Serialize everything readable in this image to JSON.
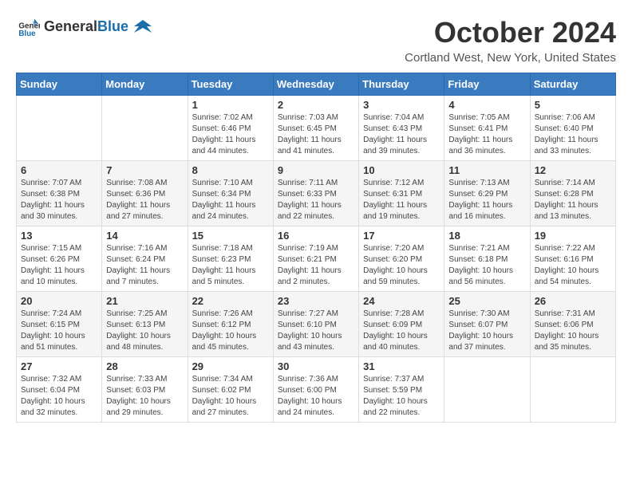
{
  "header": {
    "logo_general": "General",
    "logo_blue": "Blue",
    "month": "October 2024",
    "location": "Cortland West, New York, United States"
  },
  "weekdays": [
    "Sunday",
    "Monday",
    "Tuesday",
    "Wednesday",
    "Thursday",
    "Friday",
    "Saturday"
  ],
  "weeks": [
    [
      {
        "day": "",
        "info": ""
      },
      {
        "day": "",
        "info": ""
      },
      {
        "day": "1",
        "info": "Sunrise: 7:02 AM\nSunset: 6:46 PM\nDaylight: 11 hours and 44 minutes."
      },
      {
        "day": "2",
        "info": "Sunrise: 7:03 AM\nSunset: 6:45 PM\nDaylight: 11 hours and 41 minutes."
      },
      {
        "day": "3",
        "info": "Sunrise: 7:04 AM\nSunset: 6:43 PM\nDaylight: 11 hours and 39 minutes."
      },
      {
        "day": "4",
        "info": "Sunrise: 7:05 AM\nSunset: 6:41 PM\nDaylight: 11 hours and 36 minutes."
      },
      {
        "day": "5",
        "info": "Sunrise: 7:06 AM\nSunset: 6:40 PM\nDaylight: 11 hours and 33 minutes."
      }
    ],
    [
      {
        "day": "6",
        "info": "Sunrise: 7:07 AM\nSunset: 6:38 PM\nDaylight: 11 hours and 30 minutes."
      },
      {
        "day": "7",
        "info": "Sunrise: 7:08 AM\nSunset: 6:36 PM\nDaylight: 11 hours and 27 minutes."
      },
      {
        "day": "8",
        "info": "Sunrise: 7:10 AM\nSunset: 6:34 PM\nDaylight: 11 hours and 24 minutes."
      },
      {
        "day": "9",
        "info": "Sunrise: 7:11 AM\nSunset: 6:33 PM\nDaylight: 11 hours and 22 minutes."
      },
      {
        "day": "10",
        "info": "Sunrise: 7:12 AM\nSunset: 6:31 PM\nDaylight: 11 hours and 19 minutes."
      },
      {
        "day": "11",
        "info": "Sunrise: 7:13 AM\nSunset: 6:29 PM\nDaylight: 11 hours and 16 minutes."
      },
      {
        "day": "12",
        "info": "Sunrise: 7:14 AM\nSunset: 6:28 PM\nDaylight: 11 hours and 13 minutes."
      }
    ],
    [
      {
        "day": "13",
        "info": "Sunrise: 7:15 AM\nSunset: 6:26 PM\nDaylight: 11 hours and 10 minutes."
      },
      {
        "day": "14",
        "info": "Sunrise: 7:16 AM\nSunset: 6:24 PM\nDaylight: 11 hours and 7 minutes."
      },
      {
        "day": "15",
        "info": "Sunrise: 7:18 AM\nSunset: 6:23 PM\nDaylight: 11 hours and 5 minutes."
      },
      {
        "day": "16",
        "info": "Sunrise: 7:19 AM\nSunset: 6:21 PM\nDaylight: 11 hours and 2 minutes."
      },
      {
        "day": "17",
        "info": "Sunrise: 7:20 AM\nSunset: 6:20 PM\nDaylight: 10 hours and 59 minutes."
      },
      {
        "day": "18",
        "info": "Sunrise: 7:21 AM\nSunset: 6:18 PM\nDaylight: 10 hours and 56 minutes."
      },
      {
        "day": "19",
        "info": "Sunrise: 7:22 AM\nSunset: 6:16 PM\nDaylight: 10 hours and 54 minutes."
      }
    ],
    [
      {
        "day": "20",
        "info": "Sunrise: 7:24 AM\nSunset: 6:15 PM\nDaylight: 10 hours and 51 minutes."
      },
      {
        "day": "21",
        "info": "Sunrise: 7:25 AM\nSunset: 6:13 PM\nDaylight: 10 hours and 48 minutes."
      },
      {
        "day": "22",
        "info": "Sunrise: 7:26 AM\nSunset: 6:12 PM\nDaylight: 10 hours and 45 minutes."
      },
      {
        "day": "23",
        "info": "Sunrise: 7:27 AM\nSunset: 6:10 PM\nDaylight: 10 hours and 43 minutes."
      },
      {
        "day": "24",
        "info": "Sunrise: 7:28 AM\nSunset: 6:09 PM\nDaylight: 10 hours and 40 minutes."
      },
      {
        "day": "25",
        "info": "Sunrise: 7:30 AM\nSunset: 6:07 PM\nDaylight: 10 hours and 37 minutes."
      },
      {
        "day": "26",
        "info": "Sunrise: 7:31 AM\nSunset: 6:06 PM\nDaylight: 10 hours and 35 minutes."
      }
    ],
    [
      {
        "day": "27",
        "info": "Sunrise: 7:32 AM\nSunset: 6:04 PM\nDaylight: 10 hours and 32 minutes."
      },
      {
        "day": "28",
        "info": "Sunrise: 7:33 AM\nSunset: 6:03 PM\nDaylight: 10 hours and 29 minutes."
      },
      {
        "day": "29",
        "info": "Sunrise: 7:34 AM\nSunset: 6:02 PM\nDaylight: 10 hours and 27 minutes."
      },
      {
        "day": "30",
        "info": "Sunrise: 7:36 AM\nSunset: 6:00 PM\nDaylight: 10 hours and 24 minutes."
      },
      {
        "day": "31",
        "info": "Sunrise: 7:37 AM\nSunset: 5:59 PM\nDaylight: 10 hours and 22 minutes."
      },
      {
        "day": "",
        "info": ""
      },
      {
        "day": "",
        "info": ""
      }
    ]
  ]
}
